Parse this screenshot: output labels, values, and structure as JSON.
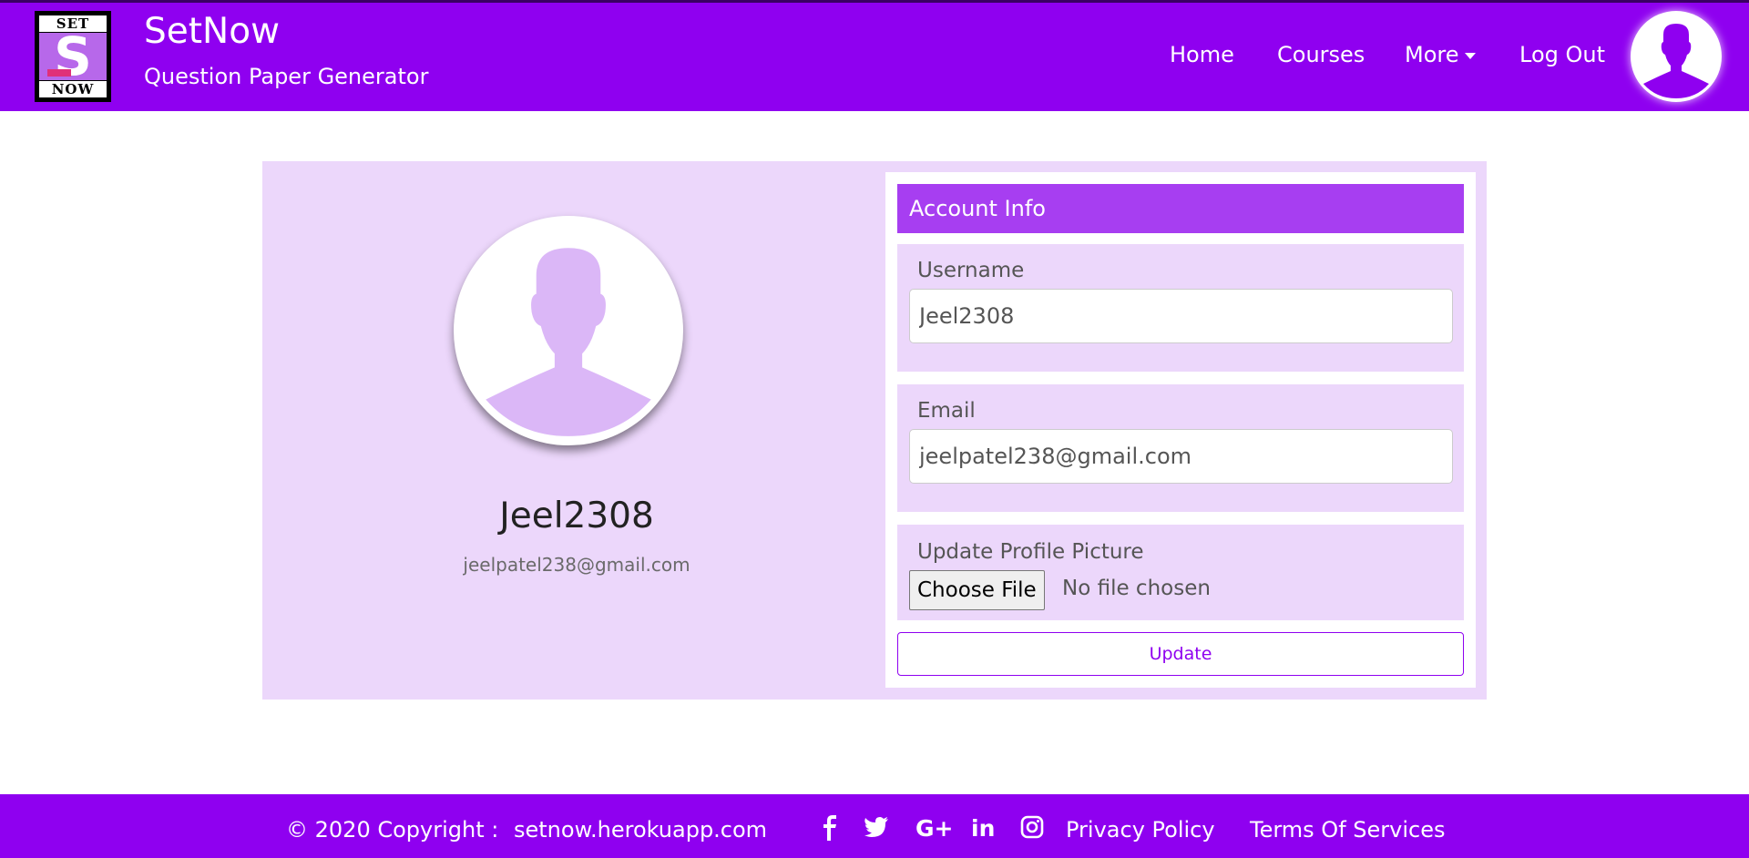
{
  "header": {
    "logo": {
      "top_text": "SET",
      "mid_letter": "S",
      "bottom_text": "NOW"
    },
    "brand_title": "SetNow",
    "brand_subtitle": "Question Paper Generator",
    "nav": {
      "home": "Home",
      "courses": "Courses",
      "more": "More",
      "logout": "Log Out"
    },
    "avatar_icon": "user-silhouette-icon"
  },
  "profile": {
    "picture_icon": "user-silhouette-icon",
    "name": "Jeel2308",
    "email": "jeelpatel238@gmail.com"
  },
  "account_info": {
    "heading": "Account Info",
    "username_label": "Username",
    "username_value": "Jeel2308",
    "email_label": "Email",
    "email_value": "jeelpatel238@gmail.com",
    "picture_label": "Update Profile Picture",
    "choose_file_label": "Choose File",
    "file_status": "No file chosen",
    "update_label": "Update"
  },
  "footer": {
    "copyright": "© 2020 Copyright :",
    "site": "setnow.herokuapp.com",
    "privacy": "Privacy Policy",
    "terms": "Terms Of Services",
    "social": {
      "facebook": "f",
      "twitter": "twitter-icon",
      "googleplus": "G+",
      "linkedin": "in",
      "instagram": "instagram-icon"
    }
  },
  "colors": {
    "brand_purple": "#8f00f0",
    "panel_header": "#a73ef1",
    "light_lavender": "#ecd7fb",
    "silhouette": "#dbb7f7"
  }
}
